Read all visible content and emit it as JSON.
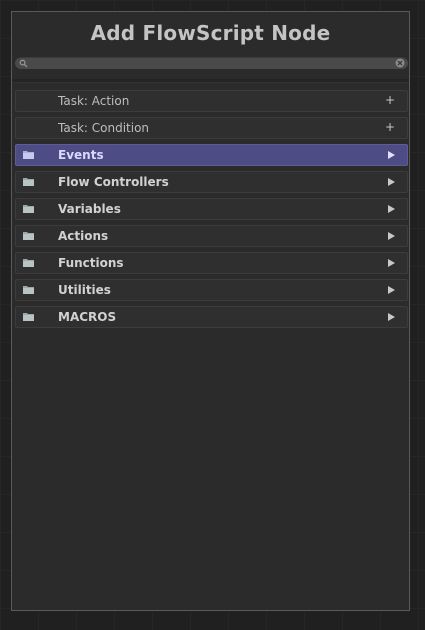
{
  "window": {
    "title": "Add FlowScript Node"
  },
  "search": {
    "value": "",
    "placeholder": "",
    "search_icon": "magnifier-icon",
    "clear_icon": "clear-x-icon"
  },
  "items": [
    {
      "label": "Task: Action",
      "kind": "task",
      "action": "+"
    },
    {
      "label": "Task: Condition",
      "kind": "task",
      "action": "+"
    },
    {
      "label": "Events",
      "kind": "category",
      "icon": "folder-icon",
      "selected": true
    },
    {
      "label": "Flow Controllers",
      "kind": "category",
      "icon": "folder-icon"
    },
    {
      "label": "Variables",
      "kind": "category",
      "icon": "folder-icon"
    },
    {
      "label": "Actions",
      "kind": "category",
      "icon": "folder-icon"
    },
    {
      "label": "Functions",
      "kind": "category",
      "icon": "folder-icon"
    },
    {
      "label": "Utilities",
      "kind": "category",
      "icon": "folder-icon"
    },
    {
      "label": "MACROS",
      "kind": "category",
      "icon": "folder-icon"
    }
  ],
  "colors": {
    "panel_background": "#2b2b2b",
    "selected_row": "#4e4c84",
    "title_text": "#c4c4c4",
    "folder_icon": "#b8c4c4"
  }
}
